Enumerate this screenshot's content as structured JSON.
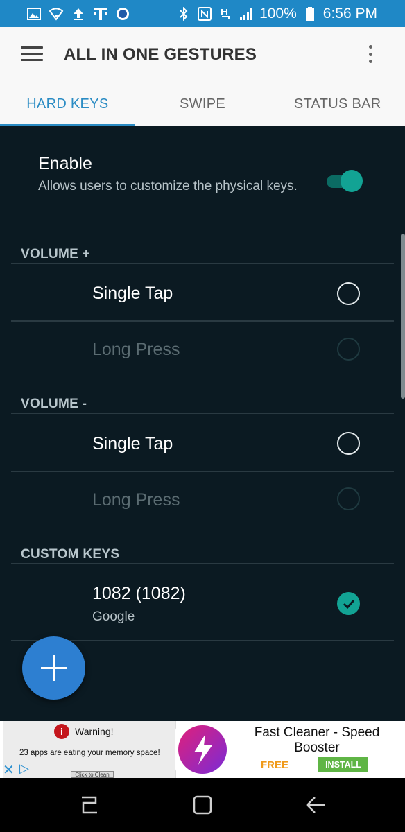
{
  "status_bar": {
    "left_icons": [
      "image-icon",
      "shield-wifi-icon",
      "upload-icon",
      "tmobile-icon",
      "mobile-app-icon"
    ],
    "right_icons": [
      "bluetooth-icon",
      "nfc-icon",
      "volte-icon",
      "signal-icon"
    ],
    "battery_percent": "100%",
    "time": "6:56 PM"
  },
  "app_bar": {
    "title": "ALL IN ONE GESTURES"
  },
  "tabs": [
    {
      "label": "HARD KEYS",
      "active": true
    },
    {
      "label": "SWIPE",
      "active": false
    },
    {
      "label": "STATUS BAR",
      "active": false
    }
  ],
  "enable": {
    "title": "Enable",
    "description": "Allows users to customize the physical keys.",
    "on": true
  },
  "sections": {
    "volume_up": {
      "header": "VOLUME +",
      "rows": [
        {
          "label": "Single Tap",
          "enabled": true,
          "checked": false
        },
        {
          "label": "Long Press",
          "enabled": false,
          "checked": false
        }
      ]
    },
    "volume_down": {
      "header": "VOLUME -",
      "rows": [
        {
          "label": "Single Tap",
          "enabled": true,
          "checked": false
        },
        {
          "label": "Long Press",
          "enabled": false,
          "checked": false
        }
      ]
    },
    "custom_keys": {
      "header": "CUSTOM KEYS",
      "rows": [
        {
          "label": "1082 (1082)",
          "sublabel": "Google",
          "enabled": true,
          "checked": true
        }
      ]
    }
  },
  "fab": {
    "icon": "plus-icon"
  },
  "ad": {
    "warning_title": "Warning!",
    "warning_badge": "i",
    "warning_body": "23 apps are eating your memory space!",
    "warning_button": "Click to Clean",
    "app_name": "Fast Cleaner - Speed Booster",
    "price": "FREE",
    "install_label": "INSTALL"
  },
  "colors": {
    "status_bar": "#1f88c6",
    "accent_blue": "#2b8cc4",
    "content_bg": "#0b1a22",
    "teal": "#12a394",
    "fab": "#2d7fd1"
  }
}
